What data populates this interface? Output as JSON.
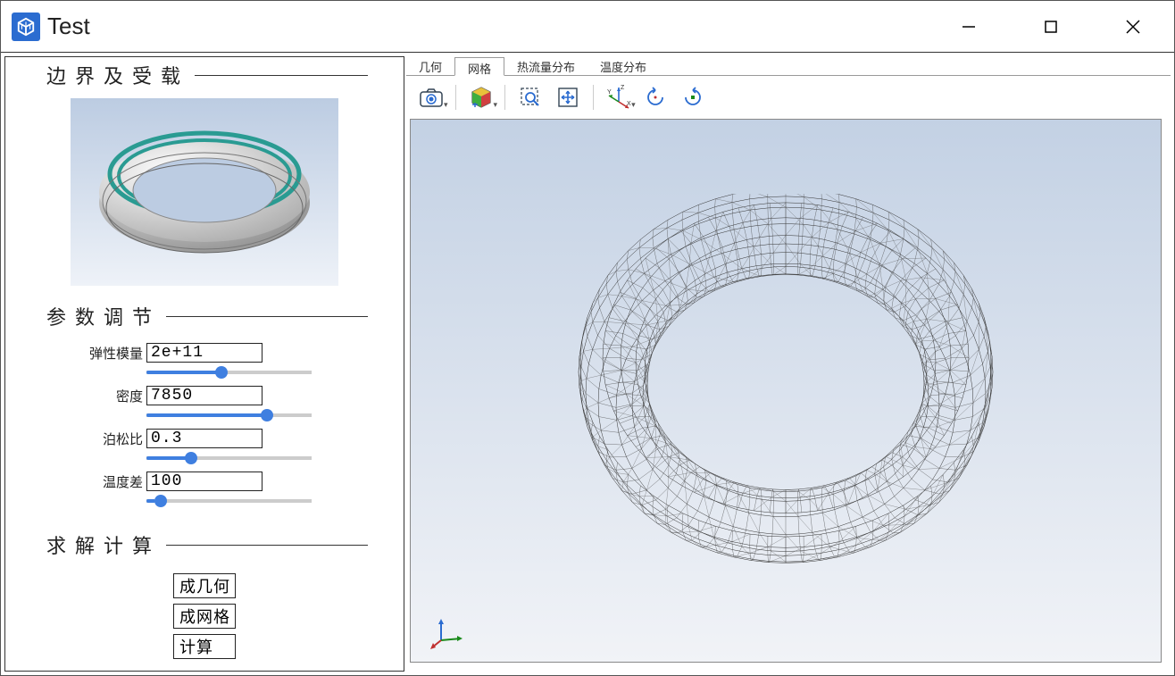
{
  "window": {
    "title": "Test"
  },
  "sidebar": {
    "section_boundary": "边界及受载",
    "section_params": "参数调节",
    "section_solve": "求解计算",
    "params": [
      {
        "label": "弹性模量",
        "value": "2e+11",
        "slider_pct": 45
      },
      {
        "label": "密度",
        "value": "7850",
        "slider_pct": 75
      },
      {
        "label": "泊松比",
        "value": "0.3",
        "slider_pct": 25
      },
      {
        "label": "温度差",
        "value": "100",
        "slider_pct": 5
      }
    ],
    "buttons": [
      {
        "label": "成几何"
      },
      {
        "label": "成网格"
      },
      {
        "label": "计算"
      }
    ]
  },
  "tabs": [
    {
      "label": "几何",
      "selected": false
    },
    {
      "label": "网格",
      "selected": true
    },
    {
      "label": "热流量分布",
      "selected": false
    },
    {
      "label": "温度分布",
      "selected": false
    }
  ],
  "toolbar_icons": {
    "camera": "camera-icon",
    "cube": "cube-color-icon",
    "zoomsel": "zoom-selection-icon",
    "fit": "fit-view-icon",
    "axes": "axes-xyz-icon",
    "rot_ccw": "rotate-ccw-icon",
    "rot_cw": "rotate-cw-icon"
  }
}
